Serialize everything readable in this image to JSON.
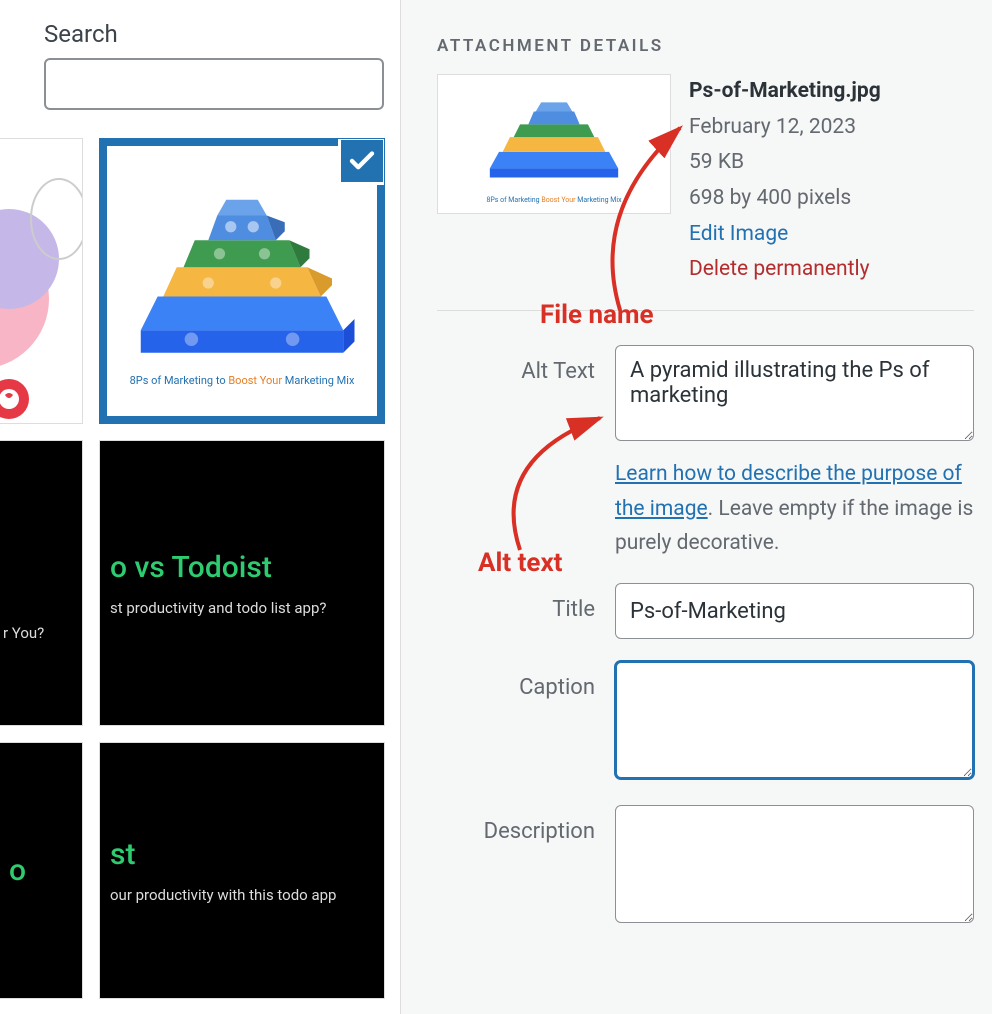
{
  "search": {
    "label": "Search",
    "value": ""
  },
  "thumbnails": {
    "pyramid_caption_a": "8Ps of Marketing",
    "pyramid_caption_b": " to ",
    "pyramid_caption_c": "Boost Your ",
    "pyramid_caption_d": "Marketing Mix",
    "black1_title": "o vs Todoist",
    "black1_sub_a": "r You?",
    "black1_sub_b": "st productivity and todo list app?",
    "black2_title_a": "o",
    "black2_title_b": "st",
    "black2_sub_a": "",
    "black2_sub_b": "our productivity with this todo app"
  },
  "details": {
    "heading": "ATTACHMENT DETAILS",
    "filename": "Ps-of-Marketing.jpg",
    "date": "February 12, 2023",
    "size": "59 KB",
    "dimensions": "698 by 400 pixels",
    "edit_link": "Edit Image",
    "delete_link": "Delete permanently"
  },
  "form": {
    "alt_label": "Alt Text",
    "alt_value": "A pyramid illustrating the Ps of marketing",
    "alt_help_link": "Learn how to describe the purpose of the image",
    "alt_help_tail": ". Leave empty if the image is purely decorative.",
    "title_label": "Title",
    "title_value": "Ps-of-Marketing",
    "caption_label": "Caption",
    "caption_value": "",
    "description_label": "Description",
    "description_value": ""
  },
  "annotations": {
    "filename": "File name",
    "alttext": "Alt text"
  }
}
